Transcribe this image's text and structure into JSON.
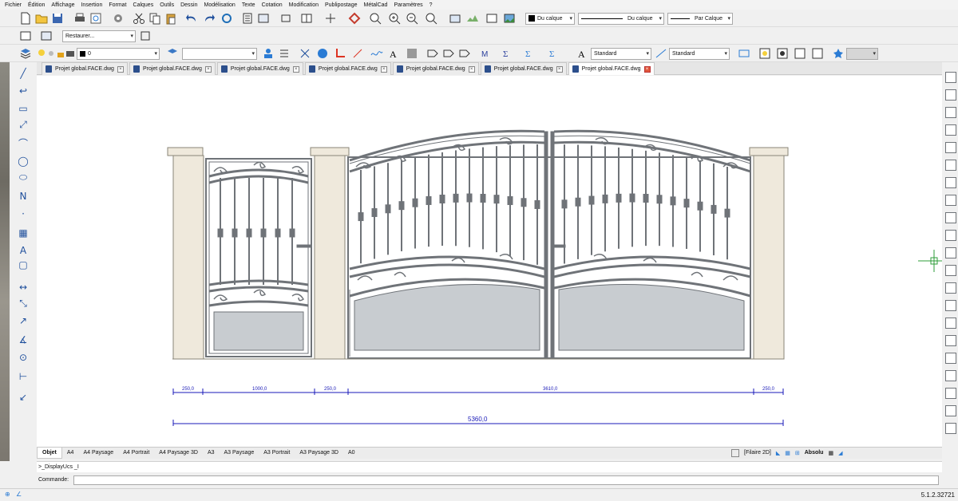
{
  "menu": [
    "Fichier",
    "Édition",
    "Affichage",
    "Insertion",
    "Format",
    "Calques",
    "Outils",
    "Dessin",
    "Modélisation",
    "Texte",
    "Cotation",
    "Modification",
    "Publipostage",
    "MétalCad",
    "Paramètres",
    "?"
  ],
  "toolbar": {
    "color_combo": "Du calque",
    "linetype_combo": "Du calque",
    "lineweight_combo": "Par Calque",
    "restore_combo": "Restaurer...",
    "layer_combo": "0",
    "text_style": "Standard",
    "dim_style": "Standard"
  },
  "doc_tabs": [
    {
      "label": "Projet global.FACE.dwg",
      "active": false
    },
    {
      "label": "Projet global.FACE.dwg",
      "active": false
    },
    {
      "label": "Projet global.FACE.dwg",
      "active": false
    },
    {
      "label": "Projet global.FACE.dwg",
      "active": false
    },
    {
      "label": "Projet global.FACE.dwg",
      "active": false
    },
    {
      "label": "Projet global.FACE.dwg",
      "active": false
    },
    {
      "label": "Projet global.FACE.dwg",
      "active": true
    }
  ],
  "drawing": {
    "dims": [
      "250,0",
      "1000,0",
      "250,0",
      "3610,0",
      "250,0"
    ],
    "total": "5360,0"
  },
  "layout_tabs": [
    "Objet",
    "A4",
    "A4 Paysage",
    "A4 Portrait",
    "A4 Paysage 3D",
    "A3",
    "A3 Paysage",
    "A3 Portrait",
    "A3 Paysage 3D",
    "A0"
  ],
  "status": {
    "view_mode": "[Filaire 2D]",
    "coord_mode": "Absolu",
    "version": "5.1.2.32721"
  },
  "command": {
    "history": ">_DisplayUcs _I",
    "prompt_label": "Commande:",
    "value": ""
  },
  "colors": {
    "dim_blue": "#1a1ab8",
    "pillar": "#efe9dc",
    "panel": "#c8ccd0",
    "frame": "#6f7378",
    "accent": "#2a7bd4"
  }
}
